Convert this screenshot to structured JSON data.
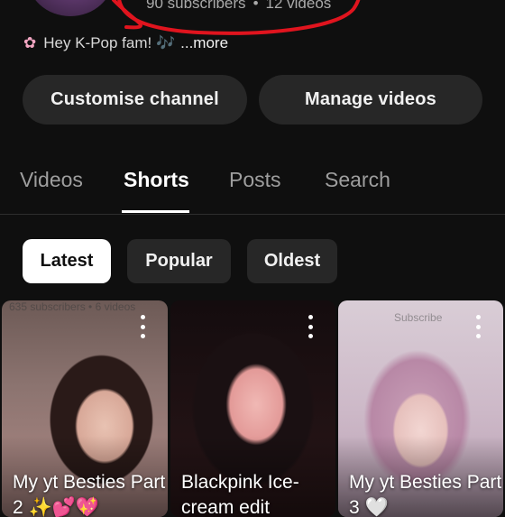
{
  "channel": {
    "subscribers": "90 subscribers",
    "separator": "•",
    "videos": "12 videos",
    "bio_icon": "flower-icon",
    "bio_text": "Hey K-Pop fam! 🎶",
    "bio_more": "...more"
  },
  "actions": {
    "customise_label": "Customise channel",
    "manage_label": "Manage videos"
  },
  "tabs": [
    {
      "label": "Videos",
      "active": false
    },
    {
      "label": "Shorts",
      "active": true
    },
    {
      "label": "Posts",
      "active": false
    },
    {
      "label": "Search",
      "active": false
    }
  ],
  "filters": [
    {
      "label": "Latest",
      "selected": true
    },
    {
      "label": "Popular",
      "selected": false
    },
    {
      "label": "Oldest",
      "selected": false
    }
  ],
  "shorts": [
    {
      "title": "My yt Besties Part 2 ✨💕💖",
      "overlay_text": "635 subscribers • 6 videos"
    },
    {
      "title": "Blackpink Ice-cream edit",
      "overlay_text": ""
    },
    {
      "title": "My yt Besties Part 3 🤍",
      "overlay_text": "Subscribe"
    }
  ],
  "colors": {
    "background": "#0f0f0f",
    "surface": "#272727",
    "scribble": "#e0141e",
    "text_primary": "#f1f1f1",
    "text_secondary": "#aaaaaa"
  }
}
